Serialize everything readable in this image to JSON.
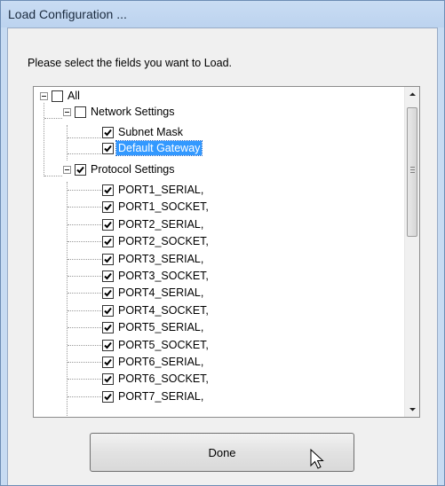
{
  "window": {
    "title": "Load Configuration ..."
  },
  "prompt": "Please select the fields you want to Load.",
  "tree": {
    "all": {
      "label": "All",
      "checked": false
    },
    "network": {
      "label": "Network Settings",
      "checked": false,
      "children": [
        {
          "label": "Subnet Mask",
          "checked": true,
          "selected": false
        },
        {
          "label": "Default Gateway",
          "checked": true,
          "selected": true
        }
      ]
    },
    "protocol": {
      "label": "Protocol Settings",
      "checked": true,
      "children": [
        {
          "label": "PORT1_SERIAL,",
          "checked": true
        },
        {
          "label": "PORT1_SOCKET,",
          "checked": true
        },
        {
          "label": "PORT2_SERIAL,",
          "checked": true
        },
        {
          "label": "PORT2_SOCKET,",
          "checked": true
        },
        {
          "label": "PORT3_SERIAL,",
          "checked": true
        },
        {
          "label": "PORT3_SOCKET,",
          "checked": true
        },
        {
          "label": "PORT4_SERIAL,",
          "checked": true
        },
        {
          "label": "PORT4_SOCKET,",
          "checked": true
        },
        {
          "label": "PORT5_SERIAL,",
          "checked": true
        },
        {
          "label": "PORT5_SOCKET,",
          "checked": true
        },
        {
          "label": "PORT6_SERIAL,",
          "checked": true
        },
        {
          "label": "PORT6_SOCKET,",
          "checked": true
        },
        {
          "label": "PORT7_SERIAL,",
          "checked": true
        }
      ]
    }
  },
  "done_button": {
    "label": "Done"
  },
  "icons": {
    "scroll_up": "scroll-up-arrow-icon",
    "scroll_down": "scroll-down-arrow-icon",
    "cursor": "mouse-pointer-icon"
  }
}
